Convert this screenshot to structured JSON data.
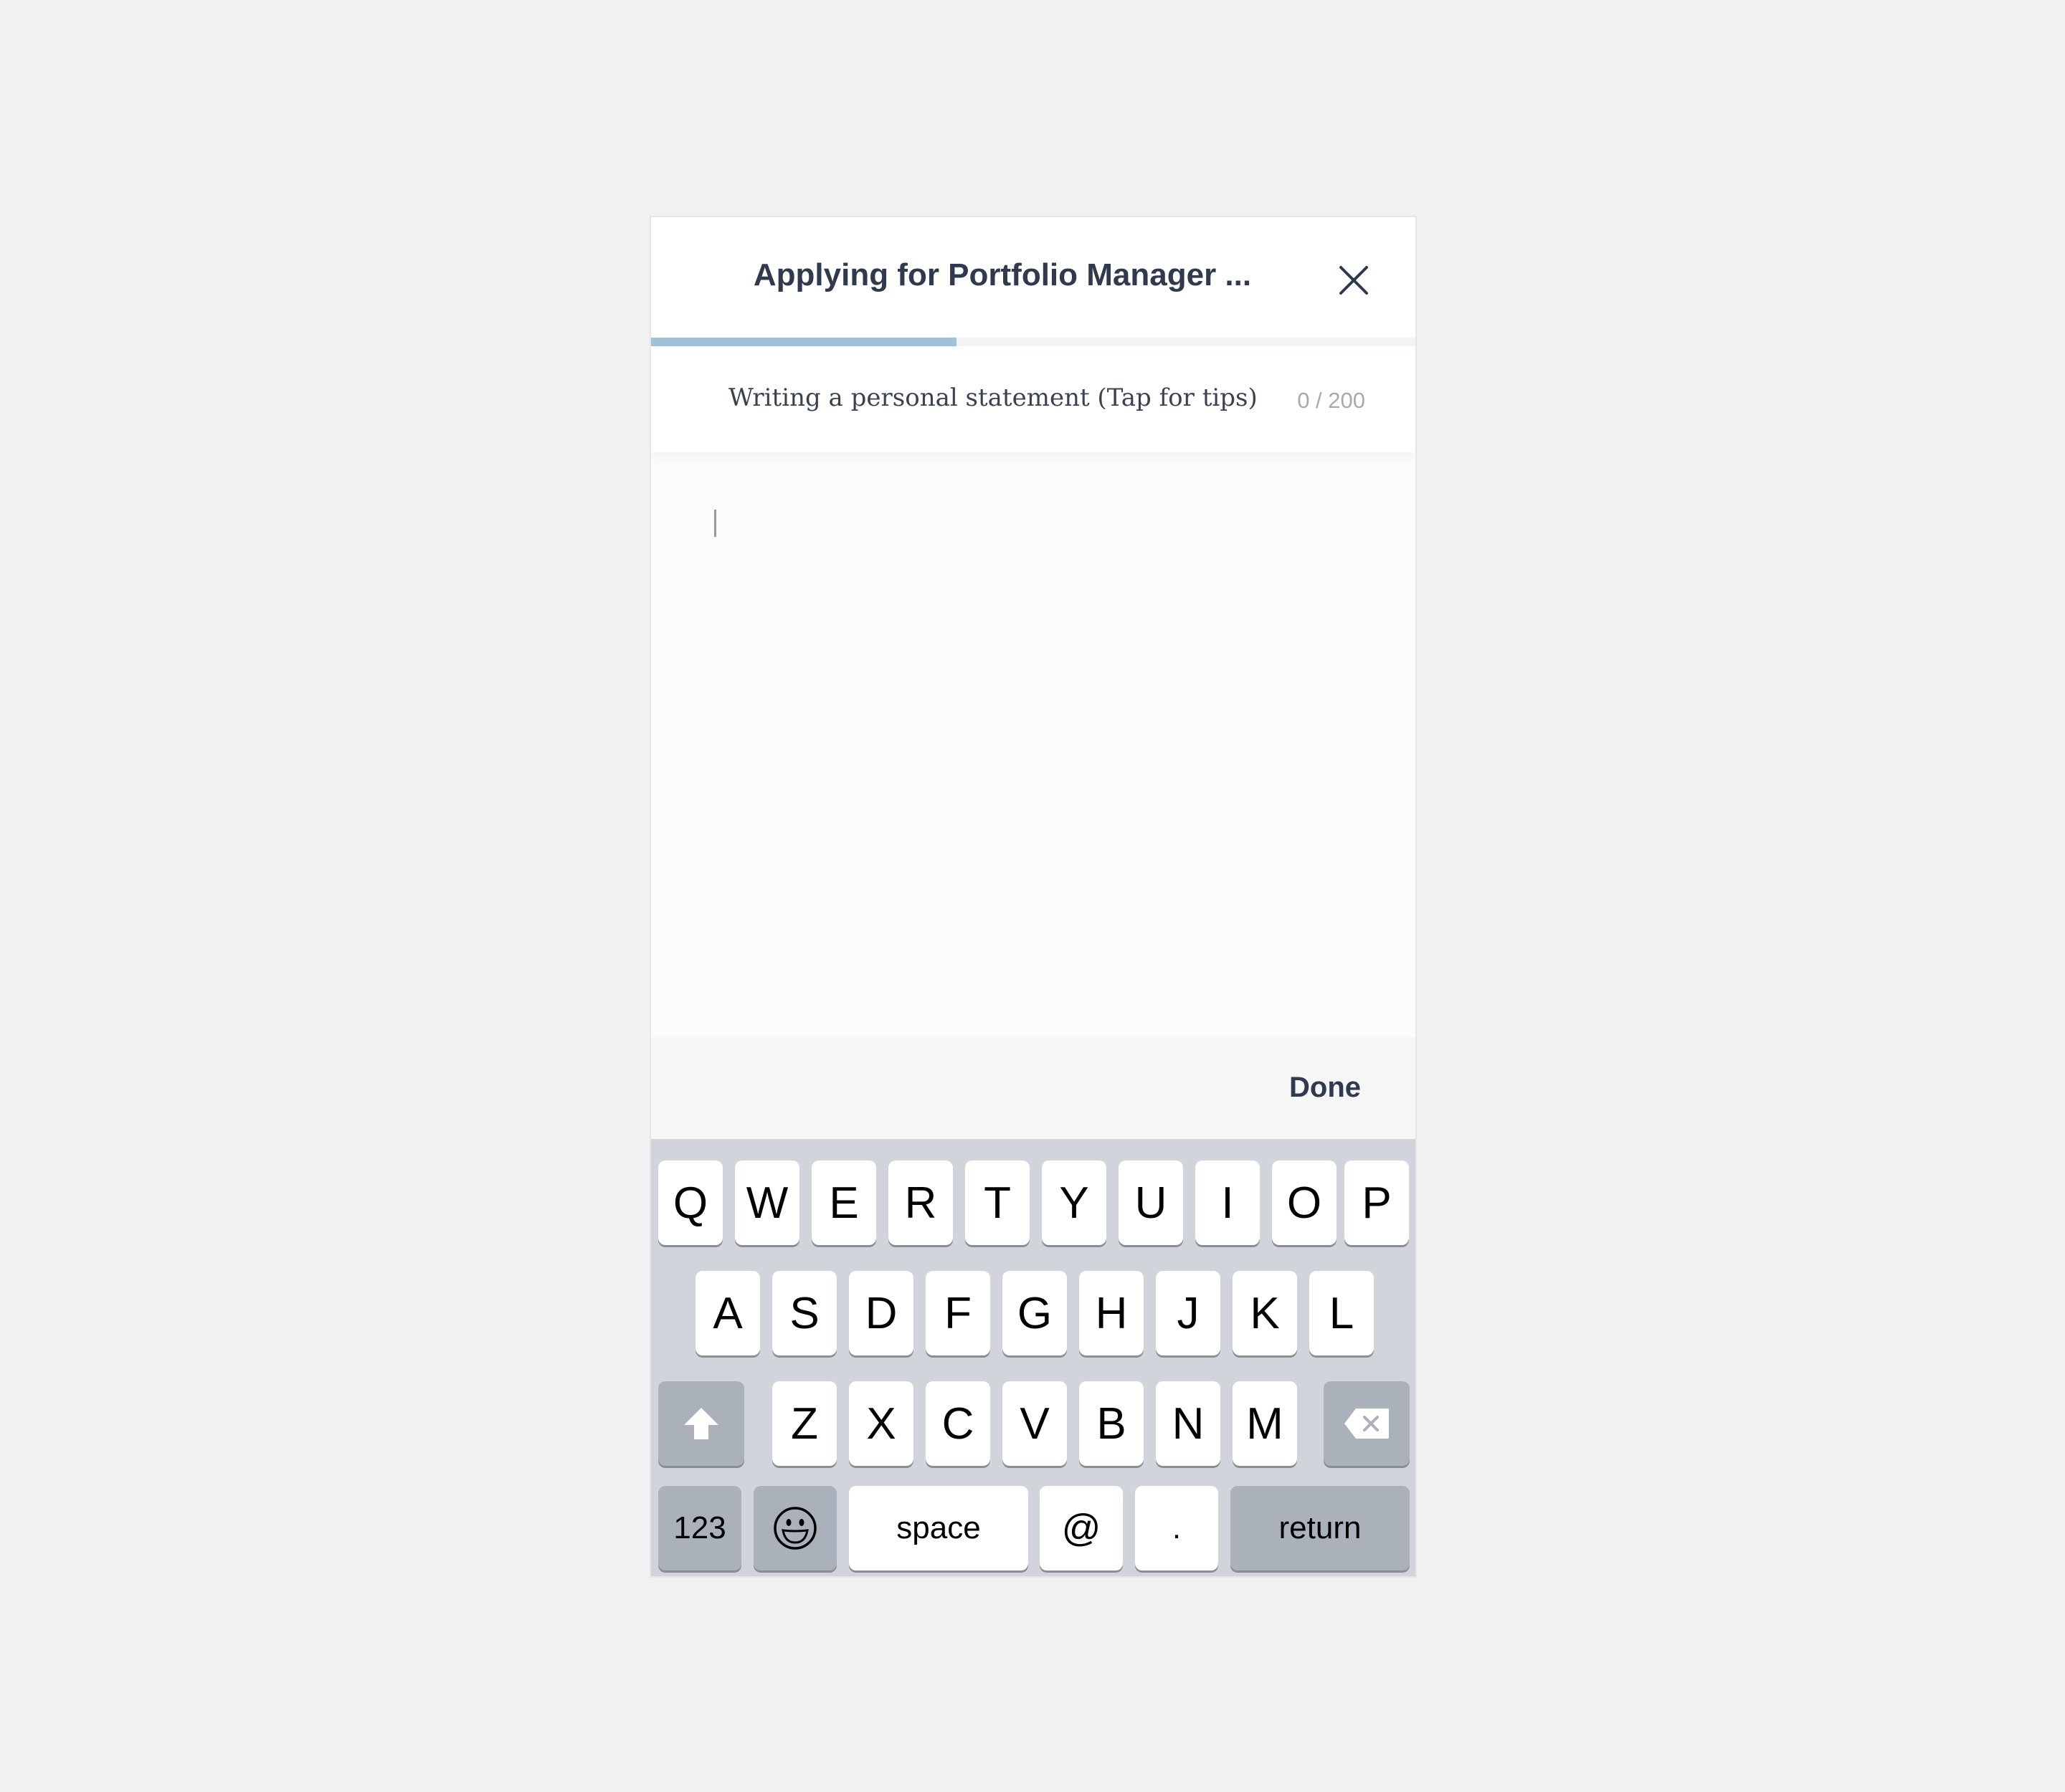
{
  "header": {
    "title": "Applying for Portfolio Manager ...",
    "close_icon": "close-icon"
  },
  "progress": {
    "fraction": 0.4,
    "color": "#9cc3d9"
  },
  "prompt": {
    "text": "Writing a personal statement (Tap for tips)",
    "count": "0 / 200"
  },
  "editor": {
    "value": ""
  },
  "toolbar": {
    "done_label": "Done"
  },
  "keyboard": {
    "row1": [
      "Q",
      "W",
      "E",
      "R",
      "T",
      "Y",
      "U",
      "I",
      "O",
      "P"
    ],
    "row2": [
      "A",
      "S",
      "D",
      "F",
      "G",
      "H",
      "J",
      "K",
      "L"
    ],
    "row3": [
      "Z",
      "X",
      "C",
      "V",
      "B",
      "N",
      "M"
    ],
    "numbers_label": "123",
    "space_label": "space",
    "at_label": "@",
    "period_label": ".",
    "return_label": "return",
    "shift_icon": "shift-icon",
    "delete_icon": "delete-icon",
    "emoji_icon": "emoji-icon"
  },
  "colors": {
    "title": "#2f3a4f",
    "keyboard_bg": "#d1d5db",
    "dark_key": "#abb1ba"
  }
}
